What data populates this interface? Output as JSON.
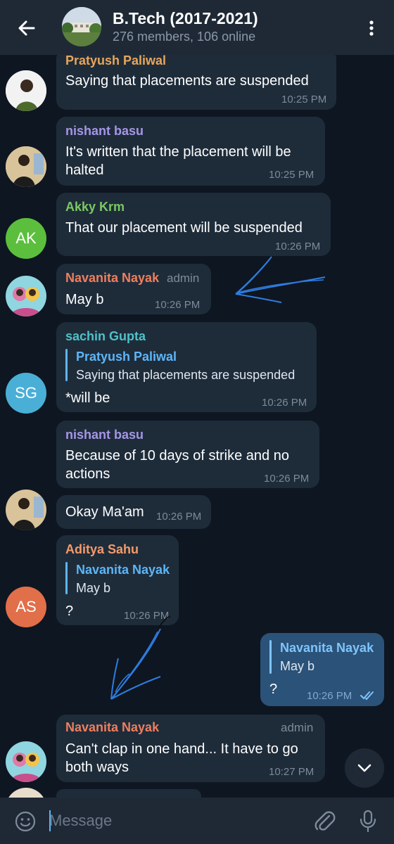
{
  "header": {
    "title": "B.Tech (2017-2021)",
    "subtitle": "276 members, 106 online"
  },
  "messages": [
    {
      "sender": "Pratyush Paliwal",
      "text": "Saying that placements are suspended",
      "time": "10:25 PM",
      "avatar": "photo"
    },
    {
      "sender": "nishant basu",
      "text_lines": [
        "It's written that the placement will be",
        "halted"
      ],
      "time": "10:25 PM",
      "avatar": "photo"
    },
    {
      "sender": "Akky Krm",
      "text": "That our placement will be suspended",
      "time": "10:26 PM",
      "avatar": "AK"
    },
    {
      "sender": "Navanita Nayak",
      "role": "admin",
      "text": "May b",
      "time": "10:26 PM",
      "avatar": "photo"
    },
    {
      "sender": "sachin Gupta",
      "reply": {
        "name": "Pratyush Paliwal",
        "text": "Saying that placements are suspended"
      },
      "text": "*will be",
      "time": "10:26 PM",
      "avatar": "SG"
    },
    {
      "sender": "nishant basu",
      "text_lines": [
        "Because of 10 days of strike and no",
        "actions"
      ],
      "time": "10:26 PM"
    },
    {
      "text": "Okay Ma'am",
      "time": "10:26 PM",
      "avatar": "photo"
    },
    {
      "sender": "Aditya Sahu",
      "reply": {
        "name": "Navanita Nayak",
        "text": "May b"
      },
      "text": "?",
      "time": "10:26 PM",
      "avatar": "AS"
    },
    {
      "outgoing": true,
      "reply": {
        "name": "Navanita Nayak",
        "text": "May b"
      },
      "text": "?",
      "time": "10:26 PM"
    },
    {
      "sender": "Navanita Nayak",
      "role": "admin",
      "text_lines": [
        "Can't clap in one hand... It have to go",
        "both ways"
      ],
      "time": "10:27 PM",
      "avatar": "photo"
    }
  ],
  "input": {
    "placeholder": "Message"
  },
  "colors": {
    "background": "#0e1621",
    "incoming_bubble": "#1e2c3a",
    "outgoing_bubble": "#2b5278",
    "accent": "#5eb5f7",
    "name_pratyush": "#e8a55a",
    "name_nishant": "#a695e7",
    "name_akky": "#7bc862",
    "name_navanita": "#ee7f5f",
    "name_sachin": "#4fc1c9",
    "name_aditya": "#f59a6b",
    "avatar_ak": "#5bbf3d",
    "avatar_sg": "#4aafd6",
    "avatar_as": "#e06f4a"
  },
  "icons": [
    "back-arrow-icon",
    "more-vert-icon",
    "emoji-icon",
    "attach-icon",
    "mic-icon",
    "chevron-down-icon",
    "double-check-icon"
  ]
}
